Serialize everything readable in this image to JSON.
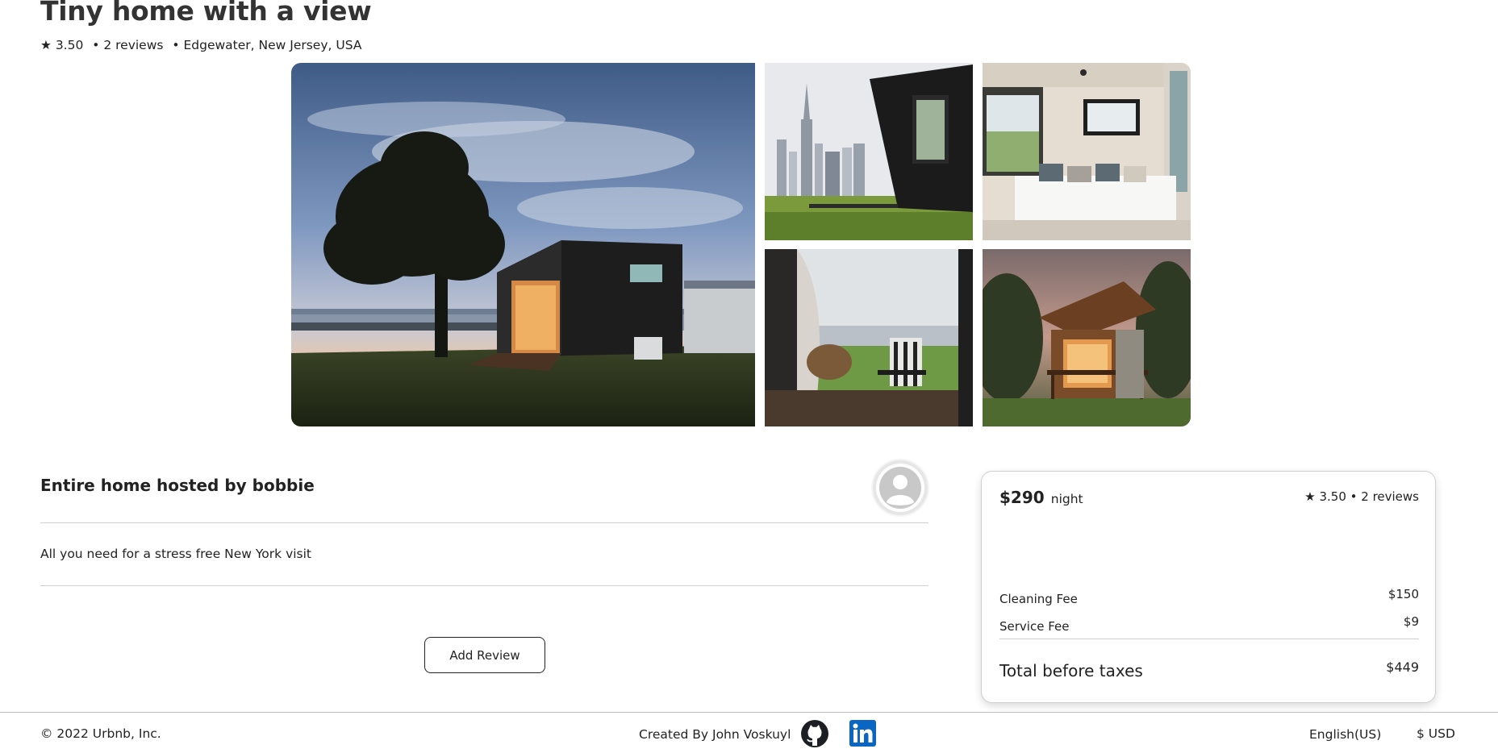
{
  "listing": {
    "title": "Tiny home with a view",
    "rating": "★ 3.50",
    "reviews": "• 2 reviews",
    "location": "• Edgewater, New Jersey, USA"
  },
  "gallery": {
    "photos": [
      {
        "alt": "Tiny cabin at sunset by a tree"
      },
      {
        "alt": "Black cabin with Manhattan skyline"
      },
      {
        "alt": "Cabin bedroom interior"
      },
      {
        "alt": "Porch chair facing river view"
      },
      {
        "alt": "Wooden cabin in the woods at dusk"
      }
    ]
  },
  "host": {
    "title": "Entire home hosted by bobbie",
    "avatar_icon": "user-avatar-icon",
    "description": "All you need for a stress free New York visit",
    "add_review_label": "Add Review"
  },
  "booking": {
    "price": "$290",
    "unit": "night",
    "rating_summary": "★ 3.50 • 2 reviews",
    "fees": [
      {
        "label": "Cleaning Fee",
        "value": "$150"
      },
      {
        "label": "Service Fee",
        "value": "$9"
      }
    ],
    "total_label": "Total before taxes",
    "total_value": "$449"
  },
  "footer": {
    "copyright": "© 2022 Urbnb, Inc.",
    "created_by": "Created By John Voskuyl",
    "github_icon": "github-icon",
    "linkedin_icon": "linkedin-icon",
    "language": "English(US)",
    "currency": "$ USD"
  },
  "colors": {
    "text": "#222222",
    "divider": "#cfcfcf",
    "linkedin": "#0a66c2"
  }
}
